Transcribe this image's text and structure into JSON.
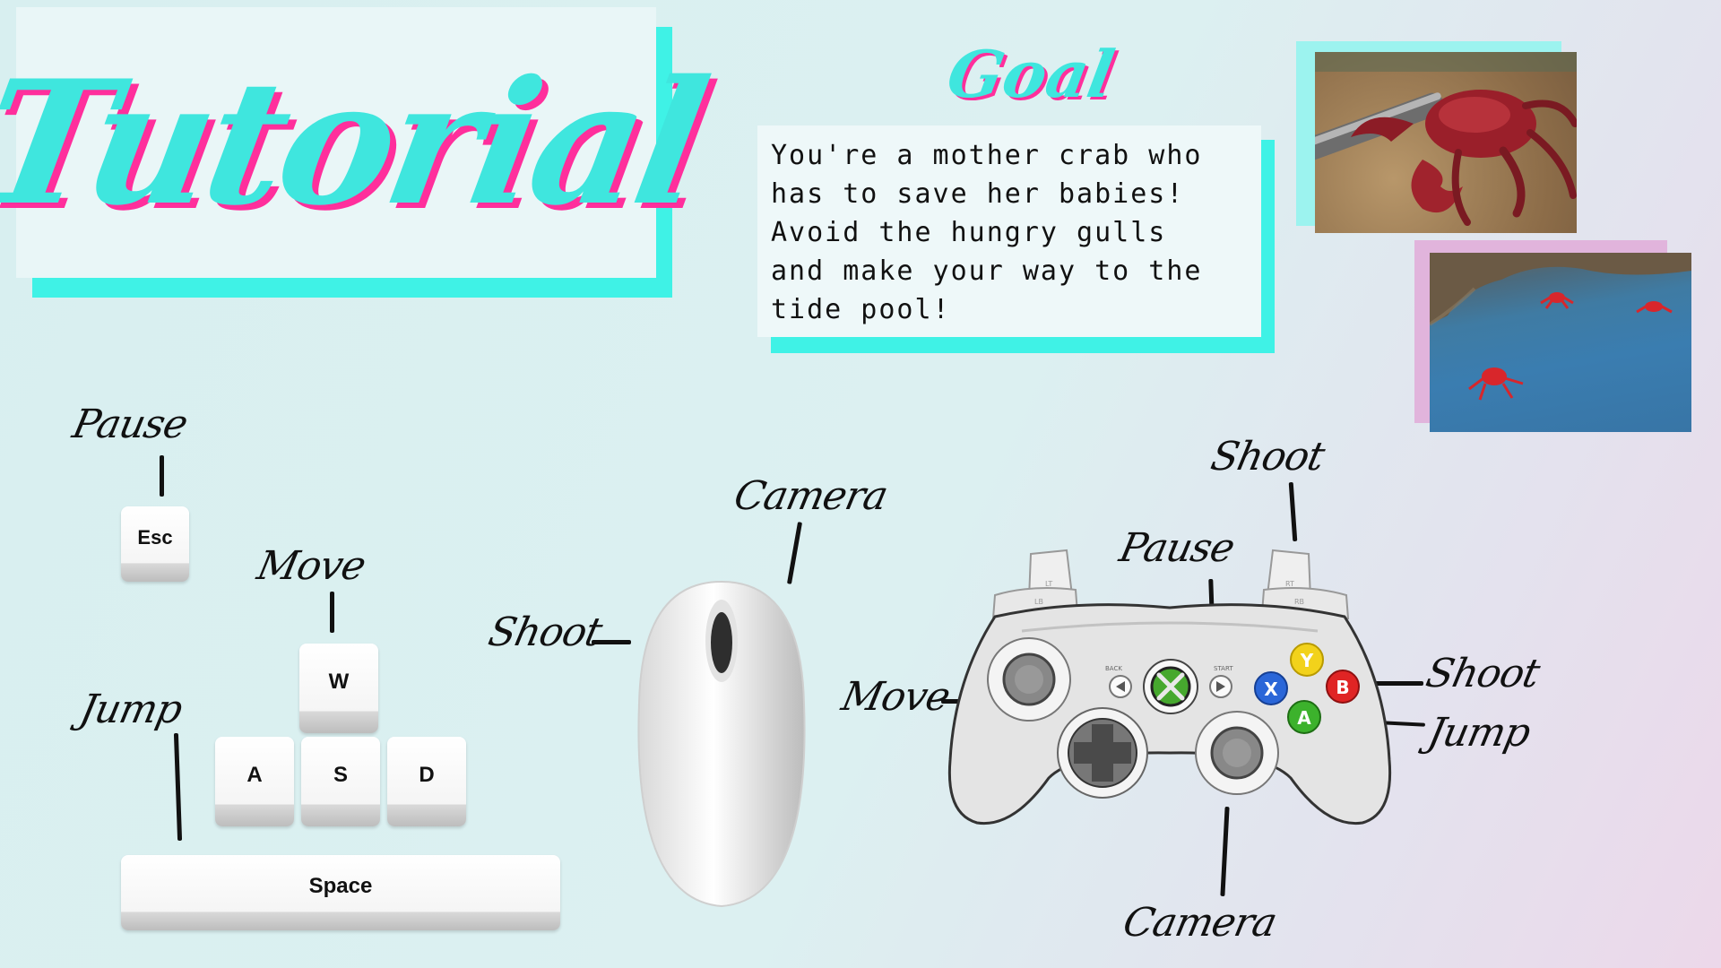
{
  "title": "Tutorial",
  "goal": {
    "heading": "Goal",
    "text": "You're a mother crab who\nhas to save her babies!\nAvoid the hungry gulls\nand make your way to the\ntide pool!"
  },
  "keyboard": {
    "keys": {
      "esc": "Esc",
      "w": "W",
      "a": "A",
      "s": "S",
      "d": "D",
      "space": "Space"
    },
    "labels": {
      "pause": "Pause",
      "move": "Move",
      "jump": "Jump"
    }
  },
  "mouse": {
    "labels": {
      "camera": "Camera",
      "shoot": "Shoot"
    }
  },
  "controller": {
    "labels": {
      "shoot_top": "Shoot",
      "pause": "Pause",
      "move": "Move",
      "shoot_right": "Shoot",
      "jump": "Jump",
      "camera": "Camera"
    },
    "buttons": {
      "y": "Y",
      "x": "X",
      "b": "B",
      "a": "A",
      "lt": "LT",
      "lb": "LB",
      "rt": "RT",
      "rb": "RB",
      "back": "BACK",
      "start": "START"
    },
    "colors": {
      "y": "#f2d21b",
      "x": "#2a66d8",
      "b": "#e02424",
      "a": "#3cb22c",
      "guide": "#46a82e"
    }
  },
  "colors": {
    "accent_cyan": "#3fe6de",
    "accent_pink": "#ff2f9c"
  },
  "icons": {
    "mouse": "mouse-icon",
    "controller": "gamepad-icon",
    "screenshot_crab": "crab-screenshot",
    "screenshot_pool": "tide-pool-screenshot"
  }
}
